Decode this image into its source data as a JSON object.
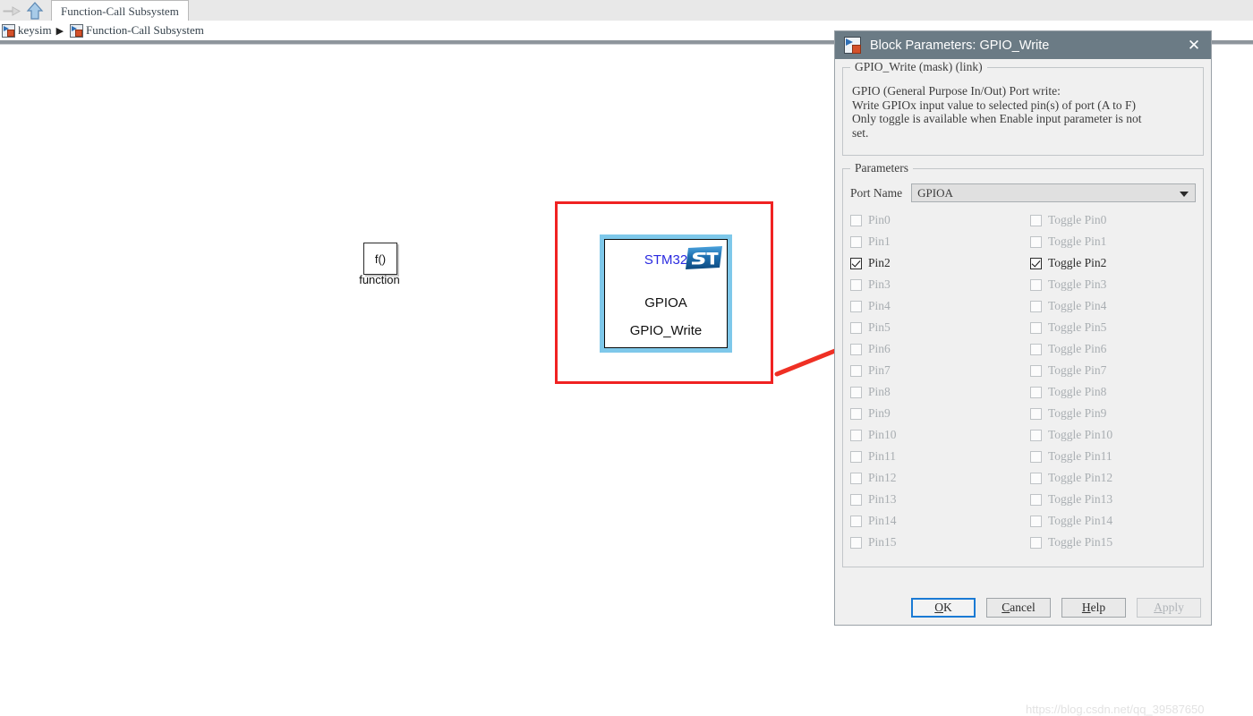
{
  "toolbar": {
    "forward_icon": "arrow-right-icon",
    "up_icon": "arrow-up-icon",
    "tab_label": "Function-Call Subsystem"
  },
  "breadcrumb": {
    "root_label": "keysim",
    "separator": "▶",
    "leaf_label": "Function-Call Subsystem"
  },
  "canvas": {
    "function_block": {
      "symbol": "f()",
      "label": "function"
    },
    "stm32_block": {
      "title": "STM32",
      "port": "GPIOA",
      "name": "GPIO_Write",
      "logo": "st-logo-icon",
      "title_color": "#2a2ae0",
      "selection_color": "#7ec8ea",
      "highlight_color": "#f02222"
    },
    "annotation_arrow": "red-arrow-annotation",
    "watermark": "https://blog.csdn.net/qq_39587650"
  },
  "dialog": {
    "icon": "simulink-block-icon",
    "title": "Block Parameters: GPIO_Write",
    "close_icon": "✕",
    "titlebar_color": "#6b7b85",
    "description": {
      "legend": "GPIO_Write (mask) (link)",
      "body": "GPIO (General Purpose In/Out) Port write:\nWrite GPIOx input value to selected pin(s) of port (A to F)\nOnly toggle is available when Enable input parameter is not\nset."
    },
    "parameters": {
      "legend": "Parameters",
      "port_name_label": "Port Name",
      "port_name_value": "GPIOA",
      "port_name_caret": "chevron-down-icon",
      "pins": [
        {
          "pin_label": "Pin0",
          "pin_checked": false,
          "pin_enabled": false,
          "toggle_label": "Toggle Pin0",
          "toggle_checked": false,
          "toggle_enabled": false
        },
        {
          "pin_label": "Pin1",
          "pin_checked": false,
          "pin_enabled": false,
          "toggle_label": "Toggle Pin1",
          "toggle_checked": false,
          "toggle_enabled": false
        },
        {
          "pin_label": "Pin2",
          "pin_checked": true,
          "pin_enabled": true,
          "toggle_label": "Toggle Pin2",
          "toggle_checked": true,
          "toggle_enabled": true
        },
        {
          "pin_label": "Pin3",
          "pin_checked": false,
          "pin_enabled": false,
          "toggle_label": "Toggle Pin3",
          "toggle_checked": false,
          "toggle_enabled": false
        },
        {
          "pin_label": "Pin4",
          "pin_checked": false,
          "pin_enabled": false,
          "toggle_label": "Toggle Pin4",
          "toggle_checked": false,
          "toggle_enabled": false
        },
        {
          "pin_label": "Pin5",
          "pin_checked": false,
          "pin_enabled": false,
          "toggle_label": "Toggle Pin5",
          "toggle_checked": false,
          "toggle_enabled": false
        },
        {
          "pin_label": "Pin6",
          "pin_checked": false,
          "pin_enabled": false,
          "toggle_label": "Toggle Pin6",
          "toggle_checked": false,
          "toggle_enabled": false
        },
        {
          "pin_label": "Pin7",
          "pin_checked": false,
          "pin_enabled": false,
          "toggle_label": "Toggle Pin7",
          "toggle_checked": false,
          "toggle_enabled": false
        },
        {
          "pin_label": "Pin8",
          "pin_checked": false,
          "pin_enabled": false,
          "toggle_label": "Toggle Pin8",
          "toggle_checked": false,
          "toggle_enabled": false
        },
        {
          "pin_label": "Pin9",
          "pin_checked": false,
          "pin_enabled": false,
          "toggle_label": "Toggle Pin9",
          "toggle_checked": false,
          "toggle_enabled": false
        },
        {
          "pin_label": "Pin10",
          "pin_checked": false,
          "pin_enabled": false,
          "toggle_label": "Toggle Pin10",
          "toggle_checked": false,
          "toggle_enabled": false
        },
        {
          "pin_label": "Pin11",
          "pin_checked": false,
          "pin_enabled": false,
          "toggle_label": "Toggle Pin11",
          "toggle_checked": false,
          "toggle_enabled": false
        },
        {
          "pin_label": "Pin12",
          "pin_checked": false,
          "pin_enabled": false,
          "toggle_label": "Toggle Pin12",
          "toggle_checked": false,
          "toggle_enabled": false
        },
        {
          "pin_label": "Pin13",
          "pin_checked": false,
          "pin_enabled": false,
          "toggle_label": "Toggle Pin13",
          "toggle_checked": false,
          "toggle_enabled": false
        },
        {
          "pin_label": "Pin14",
          "pin_checked": false,
          "pin_enabled": false,
          "toggle_label": "Toggle Pin14",
          "toggle_checked": false,
          "toggle_enabled": false
        },
        {
          "pin_label": "Pin15",
          "pin_checked": false,
          "pin_enabled": false,
          "toggle_label": "Toggle Pin15",
          "toggle_checked": false,
          "toggle_enabled": false
        }
      ]
    },
    "buttons": [
      {
        "label": "OK",
        "mnemonic": "O",
        "state": "focused"
      },
      {
        "label": "Cancel",
        "mnemonic": "C",
        "state": "normal"
      },
      {
        "label": "Help",
        "mnemonic": "H",
        "state": "normal"
      },
      {
        "label": "Apply",
        "mnemonic": "A",
        "state": "disabled"
      }
    ]
  }
}
